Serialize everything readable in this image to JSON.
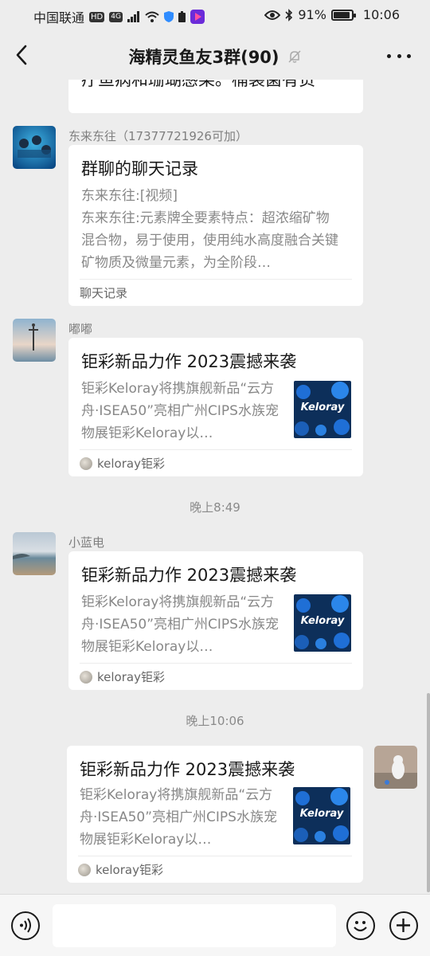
{
  "status_bar": {
    "carrier": "中国联通",
    "hd_badge": "HD",
    "network_badge": "4G",
    "battery_percent": "91%",
    "time": "10:06"
  },
  "header": {
    "title": "海精灵鱼友3群(90)"
  },
  "messages": {
    "partial_top": {
      "text": "疗鱼病和珊瑚感染。桶装菌有货"
    },
    "m1": {
      "sender": "东来东往（17377721926可加）",
      "title": "群聊的聊天记录",
      "line1": "东来东往:[视频]",
      "body": "东来东往:元素牌全要素特点：超浓缩矿物混合物，易于使用，使用纯水高度融合关键矿物质及微量元素，为全阶段…",
      "footer": "聊天记录"
    },
    "m2": {
      "sender": "嘟嘟",
      "title": "钜彩新品力作 2023震撼来袭",
      "desc": "钜彩Keloray将携旗舰新品“云方舟·ISEA50”亮相广州CIPS水族宠物展钜彩Keloray以…",
      "source": "keloray钜彩",
      "thumb_text": "Keloray"
    },
    "time1": "晚上8:49",
    "m3": {
      "sender": "小蓝电",
      "title": "钜彩新品力作 2023震撼来袭",
      "desc": "钜彩Keloray将携旗舰新品“云方舟·ISEA50”亮相广州CIPS水族宠物展钜彩Keloray以…",
      "source": "keloray钜彩",
      "thumb_text": "Keloray"
    },
    "time2": "晚上10:06",
    "m4": {
      "title": "钜彩新品力作 2023震撼来袭",
      "desc": "钜彩Keloray将携旗舰新品“云方舟·ISEA50”亮相广州CIPS水族宠物展钜彩Keloray以…",
      "source": "keloray钜彩",
      "thumb_text": "Keloray"
    }
  },
  "icons": {
    "back": "chevron-left-icon",
    "mute": "bell-off-icon",
    "more": "more-dots-icon",
    "voice": "voice-icon",
    "emoji": "emoji-icon",
    "add": "plus-icon"
  },
  "colors": {
    "background": "#ededed",
    "card": "#ffffff",
    "muted_text": "#888888"
  }
}
